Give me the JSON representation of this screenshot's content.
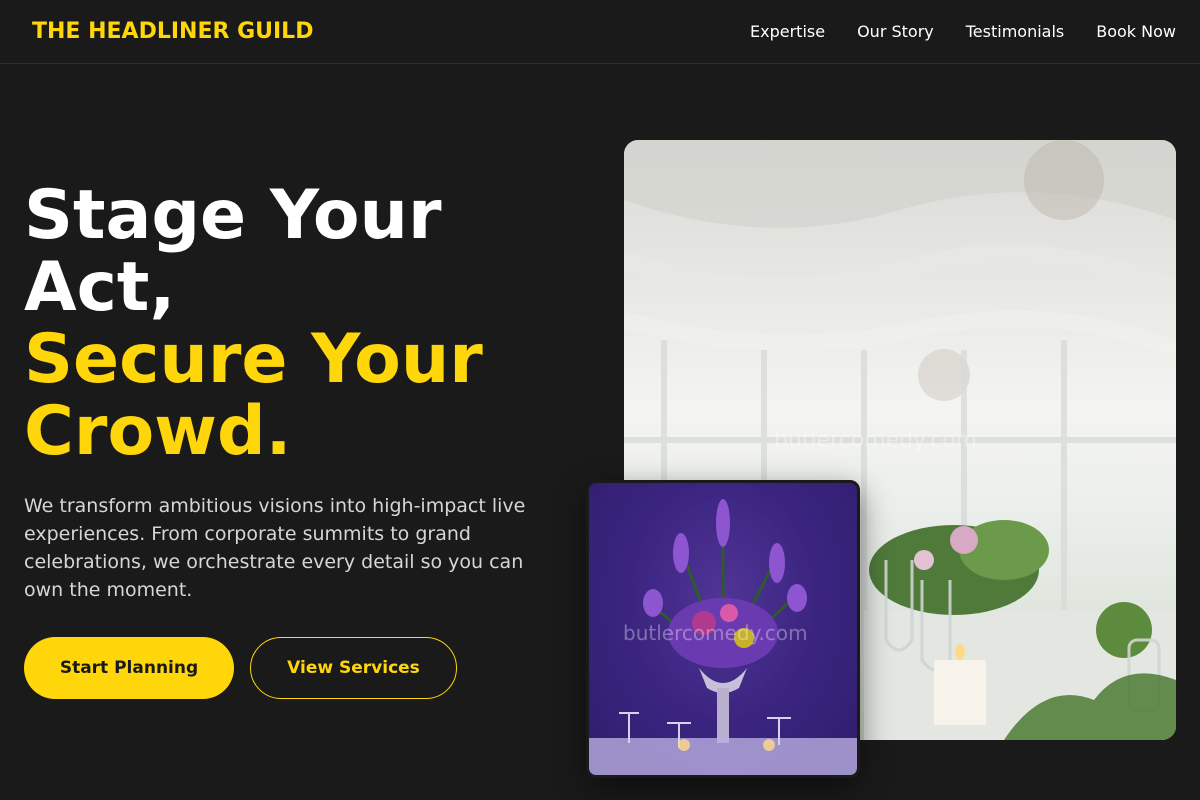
{
  "brand": "THE HEADLINER GUILD",
  "nav": {
    "items": [
      "Expertise",
      "Our Story",
      "Testimonials",
      "Book Now"
    ]
  },
  "hero": {
    "title_line1": "Stage Your",
    "title_line2": "Act,",
    "title_line3": "Secure Your",
    "title_line4": "Crowd.",
    "description": "We transform ambitious visions into high-impact live experiences. From corporate summits to grand celebrations, we orchestrate every detail so you can own the moment.",
    "primary_button": "Start Planning",
    "secondary_button": "View Services"
  },
  "images": {
    "main_watermark": "butlercomedy.com",
    "small_watermark": "butlercomedy.com"
  },
  "colors": {
    "background": "#1a1a1a",
    "accent": "#ffd60a",
    "text": "#ffffff"
  }
}
